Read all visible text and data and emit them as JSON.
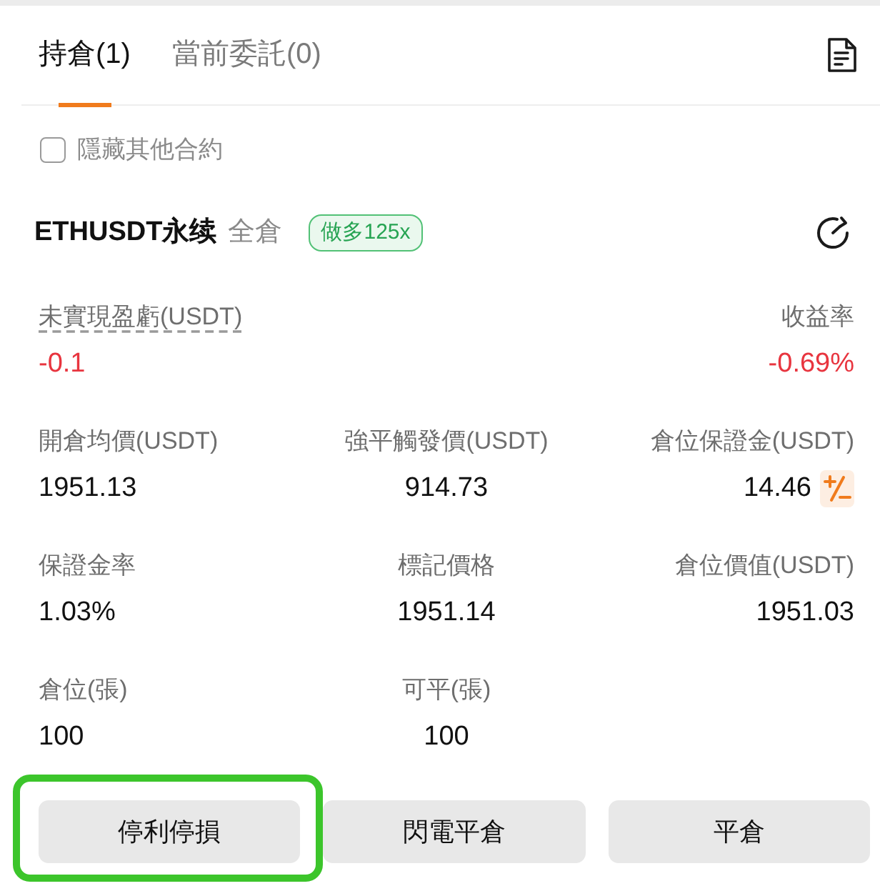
{
  "tabs": [
    {
      "label": "持倉(1)",
      "selected": true
    },
    {
      "label": "當前委託(0)",
      "selected": false
    }
  ],
  "hide_other_contracts": {
    "label": "隱藏其他合約",
    "checked": false
  },
  "position": {
    "symbol": "ETHUSDT永续",
    "margin_mode": "全倉",
    "badge": {
      "label": "做多125x",
      "long": true
    },
    "pnl": [
      {
        "label": "未實現盈虧(USDT)",
        "value": "-0.1",
        "loss": true,
        "hint": true
      },
      {
        "label": "收益率",
        "value": "-0.69%",
        "loss": true,
        "hint": false
      }
    ],
    "fields": [
      {
        "label": "開倉均價(USDT)",
        "value": "1951.13",
        "adjustable": false
      },
      {
        "label": "強平觸發價(USDT)",
        "value": "914.73",
        "adjustable": false
      },
      {
        "label": "倉位保證金(USDT)",
        "value": "14.46",
        "adjustable": true
      },
      {
        "label": "保證金率",
        "value": "1.03%",
        "adjustable": false
      },
      {
        "label": "標記價格",
        "value": "1951.14",
        "adjustable": false
      },
      {
        "label": "倉位價值(USDT)",
        "value": "1951.03",
        "adjustable": false
      },
      {
        "label": "倉位(張)",
        "value": "100",
        "adjustable": false
      },
      {
        "label": "可平(張)",
        "value": "100",
        "adjustable": false
      }
    ]
  },
  "buttons": [
    {
      "label": "停利停損",
      "highlighted": true
    },
    {
      "label": "閃電平倉",
      "highlighted": false
    },
    {
      "label": "平倉",
      "highlighted": false
    }
  ]
}
